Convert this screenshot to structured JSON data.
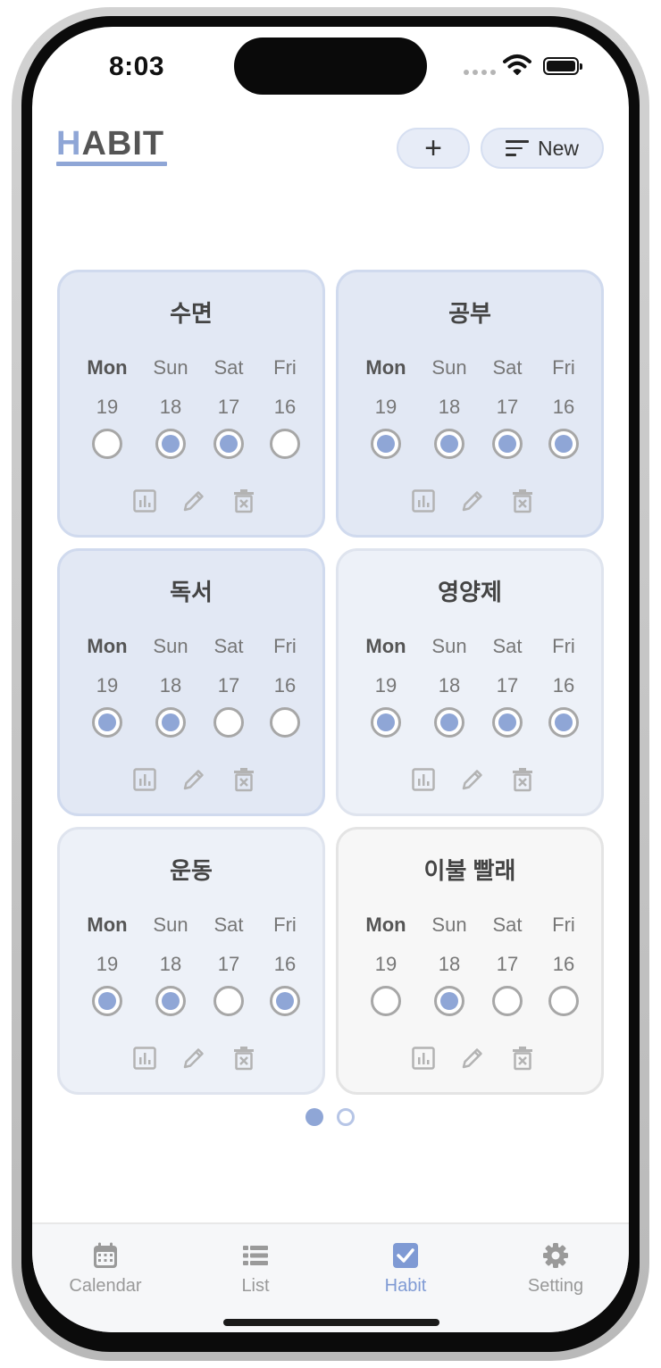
{
  "status": {
    "time": "8:03"
  },
  "header": {
    "logo_first": "H",
    "logo_rest": "ABIT",
    "add_label": "+",
    "sort_label": "New"
  },
  "weekdays": [
    "Mon",
    "Sun",
    "Sat",
    "Fri"
  ],
  "dates": [
    "19",
    "18",
    "17",
    "16"
  ],
  "habits": [
    {
      "name": "수면",
      "checks": [
        false,
        true,
        true,
        false
      ]
    },
    {
      "name": "공부",
      "checks": [
        true,
        true,
        true,
        true
      ]
    },
    {
      "name": "독서",
      "checks": [
        true,
        true,
        false,
        false
      ]
    },
    {
      "name": "영양제",
      "checks": [
        true,
        true,
        true,
        true
      ]
    },
    {
      "name": "운동",
      "checks": [
        true,
        true,
        false,
        true
      ]
    },
    {
      "name": "이불 빨래",
      "checks": [
        false,
        true,
        false,
        false
      ]
    }
  ],
  "card_icons": [
    "chart-icon",
    "pencil-icon",
    "trash-icon"
  ],
  "pagination": {
    "pages": 2,
    "current": 1
  },
  "tabbar": {
    "items": [
      {
        "label": "Calendar",
        "icon": "calendar-icon"
      },
      {
        "label": "List",
        "icon": "list-icon"
      },
      {
        "label": "Habit",
        "icon": "checkbox-icon"
      },
      {
        "label": "Setting",
        "icon": "gear-icon"
      }
    ],
    "active": "Habit"
  },
  "colors": {
    "accent": "#8fa6d6",
    "card_strong": "#e2e8f4",
    "card_mid": "#edf1f8",
    "card_light": "#f7f7f7"
  }
}
